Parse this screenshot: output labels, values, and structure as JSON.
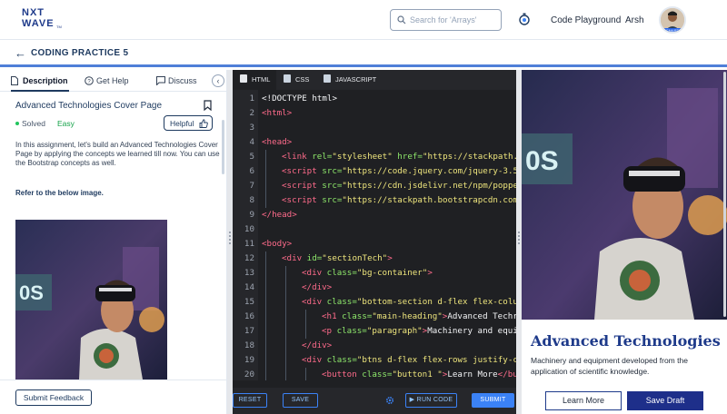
{
  "brand": {
    "line1": "NXT",
    "line2": "WAVE",
    "tm": "TM"
  },
  "search": {
    "placeholder": "Search for 'Arrays'"
  },
  "nav": {
    "playground": "Code Playground",
    "user": "Arsh",
    "avatar_badge": "SMART"
  },
  "header": {
    "title": "CODING PRACTICE 5"
  },
  "left_tabs": [
    {
      "label": "Description"
    },
    {
      "label": "Get Help"
    },
    {
      "label": "Discuss"
    }
  ],
  "question": {
    "title": "Advanced Technologies Cover Page",
    "status": "Solved",
    "difficulty": "Easy",
    "helpful": "Helpful",
    "description": "In this assignment, let's build an Advanced Technologies Cover Page by applying the concepts we learned till now. You can use the Bootstrap concepts as well.",
    "refer": "Refer to the below image."
  },
  "feedback_button": "Submit Feedback",
  "editor_tabs": [
    {
      "label": "HTML"
    },
    {
      "label": "CSS"
    },
    {
      "label": "JAVASCRIPT"
    }
  ],
  "code_lines": [
    {
      "n": "1",
      "indent": 0,
      "parts": [
        [
          "tx2",
          "<!DOCTYPE html>"
        ]
      ]
    },
    {
      "n": "2",
      "indent": 0,
      "parts": [
        [
          "tg",
          "<html>"
        ]
      ]
    },
    {
      "n": "3",
      "indent": 0,
      "parts": []
    },
    {
      "n": "4",
      "indent": 0,
      "parts": [
        [
          "tg",
          "<head>"
        ]
      ]
    },
    {
      "n": "5",
      "indent": 1,
      "parts": [
        [
          "tg",
          "<link "
        ],
        [
          "at",
          "rel="
        ],
        [
          "st",
          "\"stylesheet\" "
        ],
        [
          "at",
          "href="
        ],
        [
          "st",
          "\"https://stackpath."
        ]
      ]
    },
    {
      "n": "6",
      "indent": 1,
      "parts": [
        [
          "tg",
          "<script "
        ],
        [
          "at",
          "src="
        ],
        [
          "st",
          "\"https://code.jquery.com/jquery-3.5"
        ]
      ]
    },
    {
      "n": "7",
      "indent": 1,
      "parts": [
        [
          "tg",
          "<script "
        ],
        [
          "at",
          "src="
        ],
        [
          "st",
          "\"https://cdn.jsdelivr.net/npm/poppe"
        ]
      ]
    },
    {
      "n": "8",
      "indent": 1,
      "parts": [
        [
          "tg",
          "<script "
        ],
        [
          "at",
          "src="
        ],
        [
          "st",
          "\"https://stackpath.bootstrapcdn.com"
        ]
      ]
    },
    {
      "n": "9",
      "indent": 0,
      "parts": [
        [
          "tg",
          "</head>"
        ]
      ]
    },
    {
      "n": "10",
      "indent": 0,
      "parts": []
    },
    {
      "n": "11",
      "indent": 0,
      "parts": [
        [
          "tg",
          "<body>"
        ]
      ]
    },
    {
      "n": "12",
      "indent": 1,
      "parts": [
        [
          "tg",
          "<div "
        ],
        [
          "at",
          "id="
        ],
        [
          "st",
          "\"sectionTech\""
        ],
        [
          "tg",
          ">"
        ]
      ]
    },
    {
      "n": "13",
      "indent": 2,
      "parts": [
        [
          "tg",
          "<div "
        ],
        [
          "at",
          "class="
        ],
        [
          "st",
          "\"bg-container\""
        ],
        [
          "tg",
          ">"
        ]
      ]
    },
    {
      "n": "14",
      "indent": 2,
      "parts": [
        [
          "tg",
          "</div>"
        ]
      ]
    },
    {
      "n": "15",
      "indent": 2,
      "parts": [
        [
          "tg",
          "<div "
        ],
        [
          "at",
          "class="
        ],
        [
          "st",
          "\"bottom-section d-flex flex-colu"
        ]
      ]
    },
    {
      "n": "16",
      "indent": 3,
      "parts": [
        [
          "tg",
          "<h1 "
        ],
        [
          "at",
          "class="
        ],
        [
          "st",
          "\"main-heading\""
        ],
        [
          "tg",
          ">"
        ],
        [
          "tx2",
          "Advanced Techr"
        ]
      ]
    },
    {
      "n": "17",
      "indent": 3,
      "parts": [
        [
          "tg",
          "<p "
        ],
        [
          "at",
          "class="
        ],
        [
          "st",
          "\"paragraph\""
        ],
        [
          "tg",
          ">"
        ],
        [
          "tx2",
          "Machinery and equi"
        ]
      ]
    },
    {
      "n": "18",
      "indent": 2,
      "parts": [
        [
          "tg",
          "</div>"
        ]
      ]
    },
    {
      "n": "19",
      "indent": 2,
      "parts": [
        [
          "tg",
          "<div "
        ],
        [
          "at",
          "class="
        ],
        [
          "st",
          "\"btns d-flex flex-rows justify-c"
        ]
      ]
    },
    {
      "n": "20",
      "indent": 3,
      "parts": [
        [
          "tg",
          "<button "
        ],
        [
          "at",
          "class="
        ],
        [
          "st",
          "\"button1 \""
        ],
        [
          "tg",
          ">"
        ],
        [
          "tx2",
          "Learn More"
        ],
        [
          "tg",
          "</bu"
        ]
      ]
    },
    {
      "n": "21",
      "indent": 3,
      "parts": [
        [
          "tg",
          "<button "
        ],
        [
          "at",
          "class="
        ],
        [
          "st",
          "\"button2\""
        ],
        [
          "tg",
          ">"
        ],
        [
          "tx2",
          "Save Draft"
        ],
        [
          "tg",
          "</b"
        ]
      ]
    }
  ],
  "editor_actions": {
    "reset": "RESET",
    "save": "SAVE",
    "run": "RUN CODE",
    "submit": "SUBMIT"
  },
  "preview": {
    "heading": "Advanced Technologies",
    "paragraph": "Machinery and equipment developed from the application of scientific knowledge.",
    "btn_learn": "Learn More",
    "btn_save": "Save Draft"
  },
  "colors": {
    "accent": "#1e3a8a",
    "tag": "#ff6b8b",
    "attr": "#8ee86b",
    "string": "#ede47c",
    "editor_bg": "#1f2023"
  }
}
